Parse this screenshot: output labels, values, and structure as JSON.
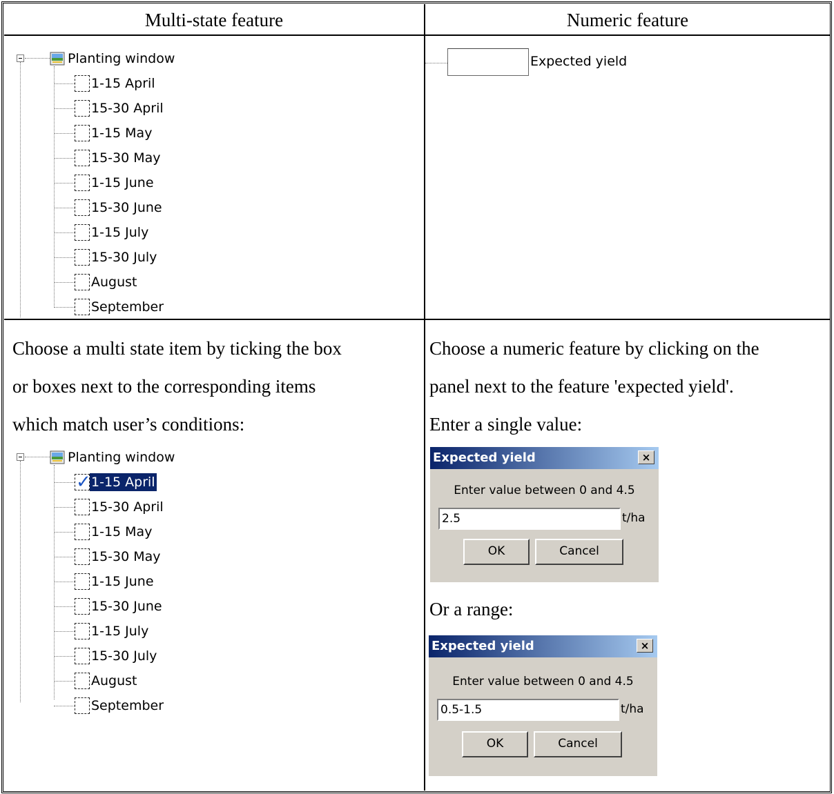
{
  "table": {
    "header_left": "Multi-state feature",
    "header_right": "Numeric feature",
    "left_instructions": [
      "Choose a multi state item by ticking the box",
      "or boxes next to the corresponding items",
      "which match user’s conditions:"
    ],
    "right_instructions": [
      "Choose a numeric feature by clicking on the",
      "panel next to the feature 'expected yield'.",
      "Enter a single value:"
    ],
    "range_caption": "Or a range:"
  },
  "tree_top": {
    "root_label": "Planting window",
    "items": [
      "1-15 April",
      "15-30 April",
      "1-15 May",
      "15-30 May",
      "1-15 June",
      "15-30 June",
      "1-15 July",
      "15-30 July",
      "August",
      "September"
    ]
  },
  "tree_bottom": {
    "root_label": "Planting window",
    "items": [
      "1-15 April",
      "15-30 April",
      "1-15 May",
      "15-30 May",
      "1-15 June",
      "15-30 June",
      "1-15 July",
      "15-30 July",
      "August",
      "September"
    ],
    "checked_item": "1-15 April"
  },
  "numeric_field": {
    "label": "Expected yield",
    "value": ""
  },
  "dialog_single": {
    "title": "Expected yield",
    "close": "×",
    "prompt": "Enter value between 0 and 4.5",
    "value": "2.5",
    "unit": "t/ha",
    "ok": "OK",
    "cancel": "Cancel"
  },
  "dialog_range": {
    "title": "Expected yield",
    "close": "×",
    "prompt": "Enter value between 0 and 4.5",
    "value": "0.5-1.5",
    "unit": "t/ha",
    "ok": "OK",
    "cancel": "Cancel"
  }
}
